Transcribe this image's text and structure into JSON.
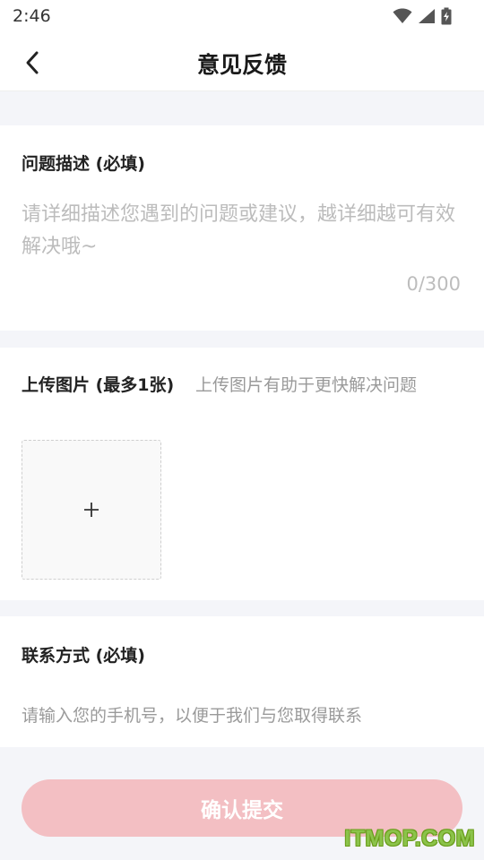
{
  "status_bar": {
    "time": "2:46",
    "icons": [
      "wifi-icon",
      "signal-icon",
      "battery-charging-icon"
    ]
  },
  "header": {
    "title": "意见反馈",
    "back_icon": "chevron-left-icon"
  },
  "description": {
    "label": "问题描述 (必填)",
    "placeholder": "请详细描述您遇到的问题或建议，越详细越可有效解决哦~",
    "value": "",
    "counter": "0/300"
  },
  "upload": {
    "label": "上传图片 (最多1张)",
    "hint": "上传图片有助于更快解决问题",
    "add_icon": "plus-icon"
  },
  "contact": {
    "label": "联系方式 (必填)",
    "placeholder": "请输入您的手机号，以便于我们与您取得联系",
    "value": ""
  },
  "submit": {
    "label": "确认提交",
    "color": "#f3bfc3"
  },
  "watermark": "ITMOP.COM",
  "colors": {
    "background": "#f4f5f9",
    "card": "#ffffff",
    "placeholder": "#bcbcbc",
    "watermark": "#8bc34a"
  }
}
